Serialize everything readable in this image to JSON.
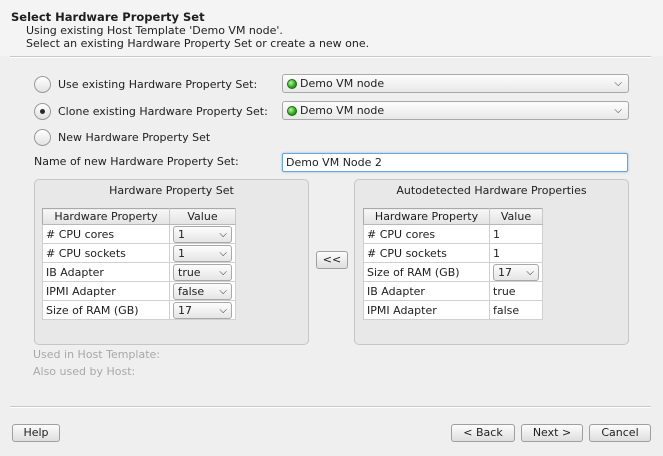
{
  "header": {
    "title": "Select Hardware Property Set",
    "sub1": "Using existing Host Template 'Demo VM node'.",
    "sub2": "Select an existing Hardware Property Set or create a new one."
  },
  "options": {
    "use_existing_label": "Use existing Hardware Property Set:",
    "use_existing_value": "Demo VM node",
    "clone_label": "Clone existing Hardware Property Set:",
    "clone_value": "Demo VM node",
    "new_label": "New Hardware Property Set",
    "selected": "clone"
  },
  "name_field": {
    "label": "Name of new Hardware Property Set:",
    "value": "Demo VM Node 2"
  },
  "left_group": {
    "title": "Hardware Property Set",
    "col1": "Hardware Property",
    "col2": "Value",
    "rows": [
      {
        "prop": "# CPU cores",
        "value": "1"
      },
      {
        "prop": "# CPU sockets",
        "value": "1"
      },
      {
        "prop": "IB Adapter",
        "value": "true"
      },
      {
        "prop": "IPMI Adapter",
        "value": "false"
      },
      {
        "prop": "Size of RAM (GB)",
        "value": "17"
      }
    ]
  },
  "copy_button": "<<",
  "right_group": {
    "title": "Autodetected Hardware Properties",
    "col1": "Hardware Property",
    "col2": "Value",
    "rows": [
      {
        "prop": "# CPU cores",
        "value": "1"
      },
      {
        "prop": "# CPU sockets",
        "value": "1"
      },
      {
        "prop": "Size of RAM (GB)",
        "value": "17"
      },
      {
        "prop": "IB Adapter",
        "value": "true"
      },
      {
        "prop": "IPMI Adapter",
        "value": "false"
      }
    ]
  },
  "info": {
    "used_in": "Used in Host Template:",
    "also_used": "Also used by Host:"
  },
  "buttons": {
    "help": "Help",
    "back": "< Back",
    "next": "Next >",
    "cancel": "Cancel"
  }
}
